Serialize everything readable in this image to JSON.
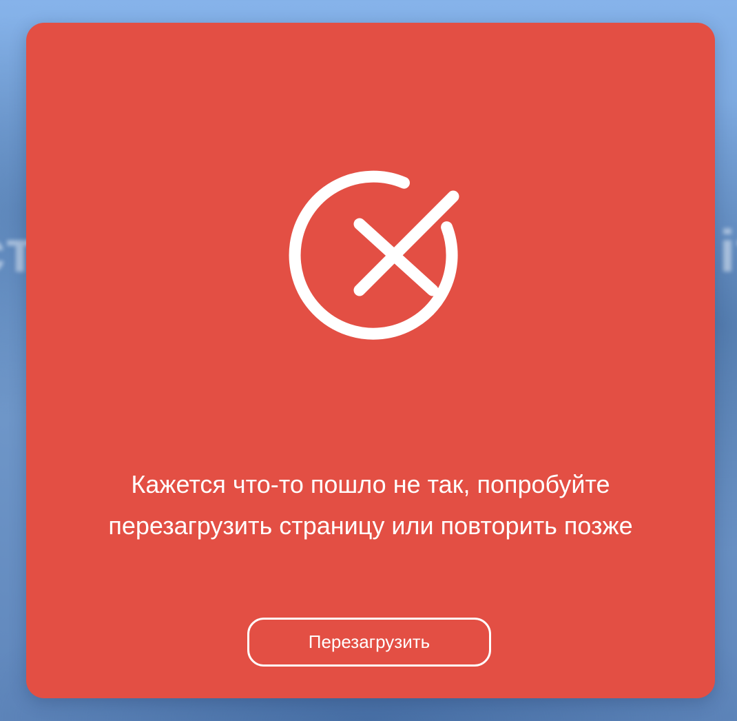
{
  "background": {
    "blurred_text_left": "ст",
    "blurred_text_right": "іт"
  },
  "error_card": {
    "color": "#e34f44",
    "icon": "error-x-circle-icon",
    "message": "Кажется что-то пошло не так, попробуйте перезагрузить страницу или повторить позже",
    "reload_button_label": "Перезагрузить"
  }
}
